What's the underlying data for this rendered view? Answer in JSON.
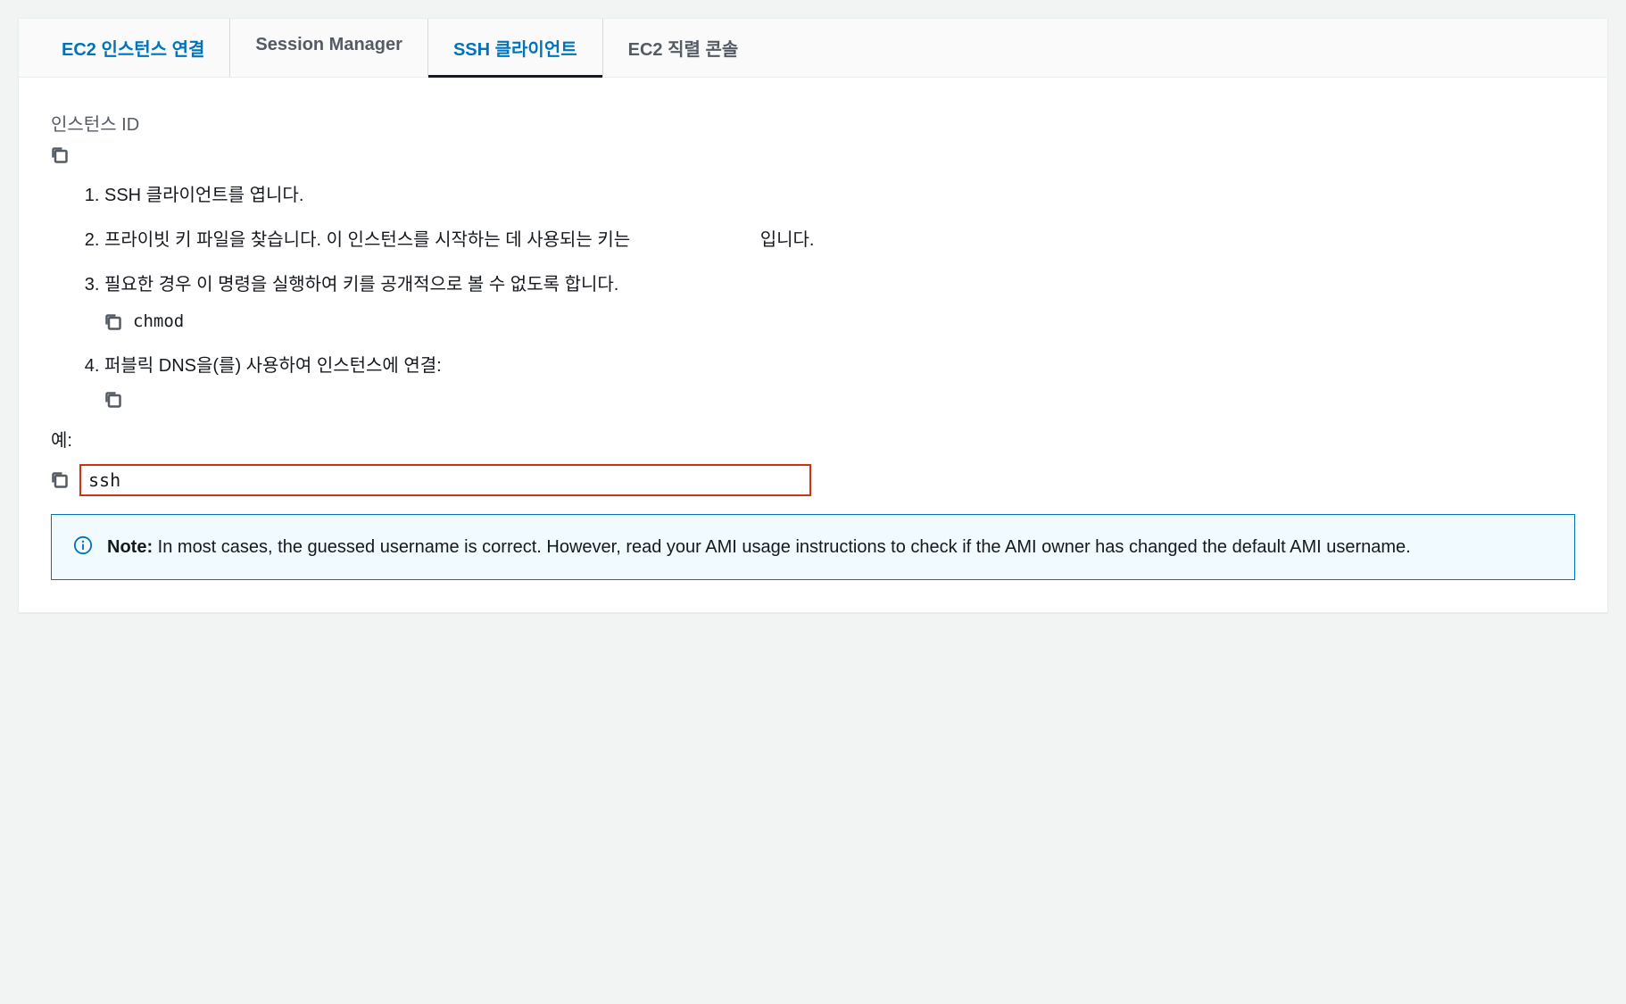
{
  "tabs": {
    "ec2_connect": "EC2 인스턴스 연결",
    "session_manager": "Session Manager",
    "ssh_client": "SSH 클라이언트",
    "serial_console": "EC2 직렬 콘솔"
  },
  "instance_id_label": "인스턴스 ID",
  "steps": {
    "s1": "SSH 클라이언트를 엽니다.",
    "s2_prefix": "프라이빗 키 파일을 찾습니다. 이 인스턴스를 시작하는 데 사용되는 키는",
    "s2_suffix": "입니다.",
    "s3": "필요한 경우 이 명령을 실행하여 키를 공개적으로 볼 수 없도록 합니다.",
    "s3_code": "chmod ",
    "s4": "퍼블릭 DNS을(를) 사용하여 인스턴스에 연결:"
  },
  "example_label": "예:",
  "example_code": "ssh",
  "note": {
    "label": "Note:",
    "text": " In most cases, the guessed username is correct. However, read your AMI usage instructions to check if the AMI owner has changed the default AMI username."
  }
}
